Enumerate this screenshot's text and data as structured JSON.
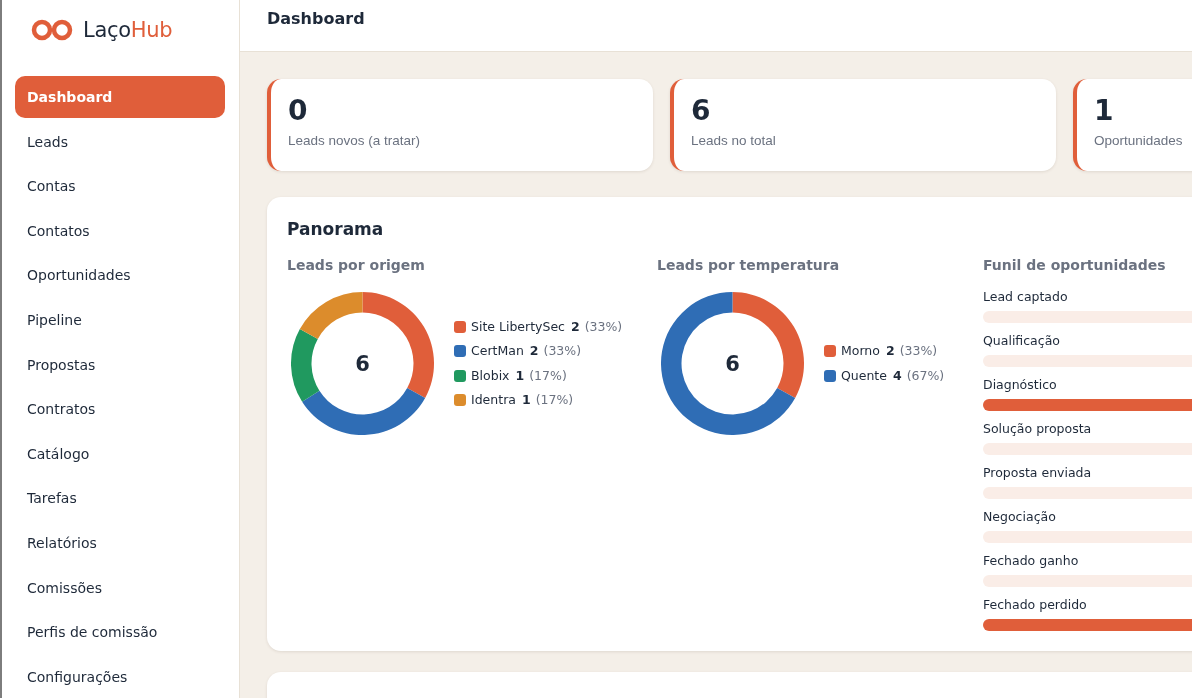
{
  "brand": {
    "parts": [
      {
        "text": "Laço",
        "accent": false
      },
      {
        "text": "Hub",
        "accent": true
      }
    ]
  },
  "sidebar": {
    "items": [
      {
        "label": "Dashboard",
        "selected": true
      },
      {
        "label": "Leads",
        "selected": false
      },
      {
        "label": "Contas",
        "selected": false
      },
      {
        "label": "Contatos",
        "selected": false
      },
      {
        "label": "Oportunidades",
        "selected": false
      },
      {
        "label": "Pipeline",
        "selected": false
      },
      {
        "label": "Propostas",
        "selected": false
      },
      {
        "label": "Contratos",
        "selected": false
      },
      {
        "label": "Catálogo",
        "selected": false
      },
      {
        "label": "Tarefas",
        "selected": false
      },
      {
        "label": "Relatórios",
        "selected": false
      },
      {
        "label": "Comissões",
        "selected": false
      },
      {
        "label": "Perfis de comissão",
        "selected": false
      },
      {
        "label": "Configurações",
        "selected": false
      }
    ]
  },
  "header": {
    "title": "Dashboard"
  },
  "stats": [
    {
      "value": "0",
      "label": "Leads novos (a tratar)"
    },
    {
      "value": "6",
      "label": "Leads no total"
    },
    {
      "value": "1",
      "label": "Oportunidades"
    }
  ],
  "panorama": {
    "title": "Panorama",
    "charts": [
      {
        "total": "6",
        "legend": [
          {
            "count": "2",
            "share": "(33%)",
            "color": "#e05e3a"
          },
          {
            "count": "2",
            "share": "(33%)",
            "color": "#2f6db5"
          },
          {
            "count": "1",
            "share": "(17%)",
            "color": "#20995f"
          },
          {
            "count": "1",
            "share": "(17%)",
            "color": "#dc8c2c"
          }
        ],
        "chart_data": {
          "type": "donut",
          "title": "Leads por origem",
          "categories": [
            "Site LibertySec",
            "CertMan",
            "Blobix",
            "Identra"
          ],
          "values": [
            33,
            33,
            17,
            17
          ]
        }
      },
      {
        "total": "6",
        "legend": [
          {
            "count": "2",
            "share": "(33%)",
            "color": "#e05e3a"
          },
          {
            "count": "4",
            "share": "(67%)",
            "color": "#2f6db5"
          }
        ],
        "chart_data": {
          "type": "donut",
          "title": "Leads por temperatura",
          "categories": [
            "Morno",
            "Quente"
          ],
          "values": [
            33,
            67
          ]
        }
      }
    ],
    "funnel": {
      "title": "Funil de oportunidades",
      "stages": [
        {
          "label": "Lead captado",
          "filled": false
        },
        {
          "label": "Qualificação",
          "filled": false
        },
        {
          "label": "Diagnóstico",
          "filled": true
        },
        {
          "label": "Solução proposta",
          "filled": false
        },
        {
          "label": "Proposta enviada",
          "filled": false
        },
        {
          "label": "Negociação",
          "filled": false
        },
        {
          "label": "Fechado ganho",
          "filled": false
        },
        {
          "label": "Fechado perdido",
          "filled": true
        }
      ]
    }
  }
}
